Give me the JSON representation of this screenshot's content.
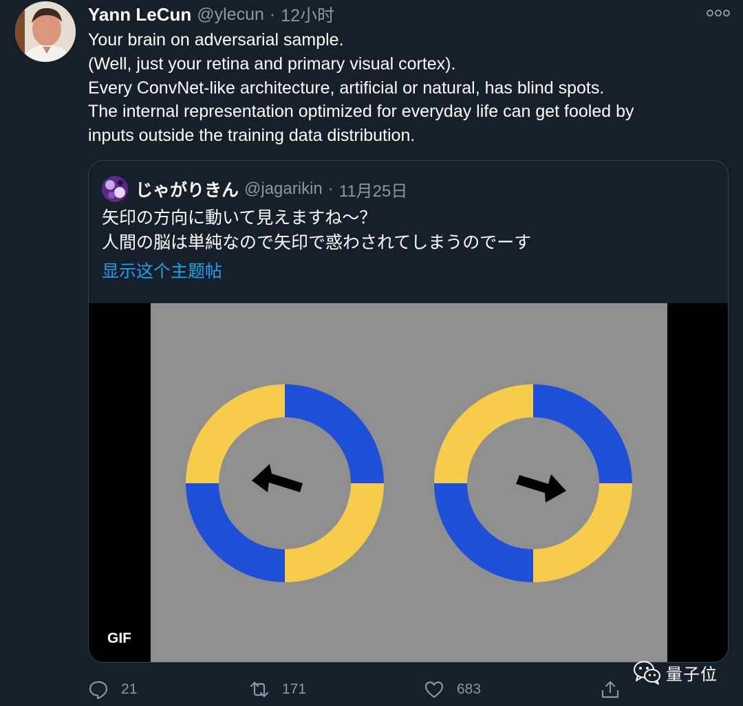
{
  "tweet": {
    "author_name": "Yann LeCun",
    "author_handle": "@ylecun",
    "separator": "·",
    "timestamp": "12小时",
    "more_icon": "more-horizontal-icon",
    "text_lines": [
      "Your brain on adversarial sample.",
      "(Well, just your retina and primary visual cortex).",
      "Every ConvNet-like architecture, artificial or natural, has blind spots.",
      "The internal representation optimized for everyday life can get fooled by",
      "inputs outside the training data distribution."
    ]
  },
  "quoted_tweet": {
    "author_name": "じゃがりきん",
    "author_handle": "@jagarikin",
    "separator": "·",
    "timestamp": "11月25日",
    "text_lines": [
      "矢印の方向に動いて見えますね～？",
      "人間の脳は単純なので矢印で惑わされてしまうのでーす"
    ],
    "show_thread_label": "显示这个主题帖",
    "media": {
      "badge": "GIF",
      "colors": {
        "background": "#8f8f8f",
        "yellow": "#f8cc4b",
        "blue": "#1e4fd8",
        "arrow": "#000000"
      }
    }
  },
  "actions": {
    "reply": {
      "icon": "reply-icon",
      "count": "21"
    },
    "retweet": {
      "icon": "retweet-icon",
      "count": "171"
    },
    "like": {
      "icon": "heart-icon",
      "count": "683"
    },
    "share": {
      "icon": "share-icon"
    }
  },
  "watermark": {
    "icon": "wechat-icon",
    "text": "量子位"
  },
  "colors": {
    "background": "#15202b",
    "text_primary": "#ffffff",
    "text_secondary": "#8899a6",
    "link": "#1da1f2",
    "border": "#38444d"
  }
}
